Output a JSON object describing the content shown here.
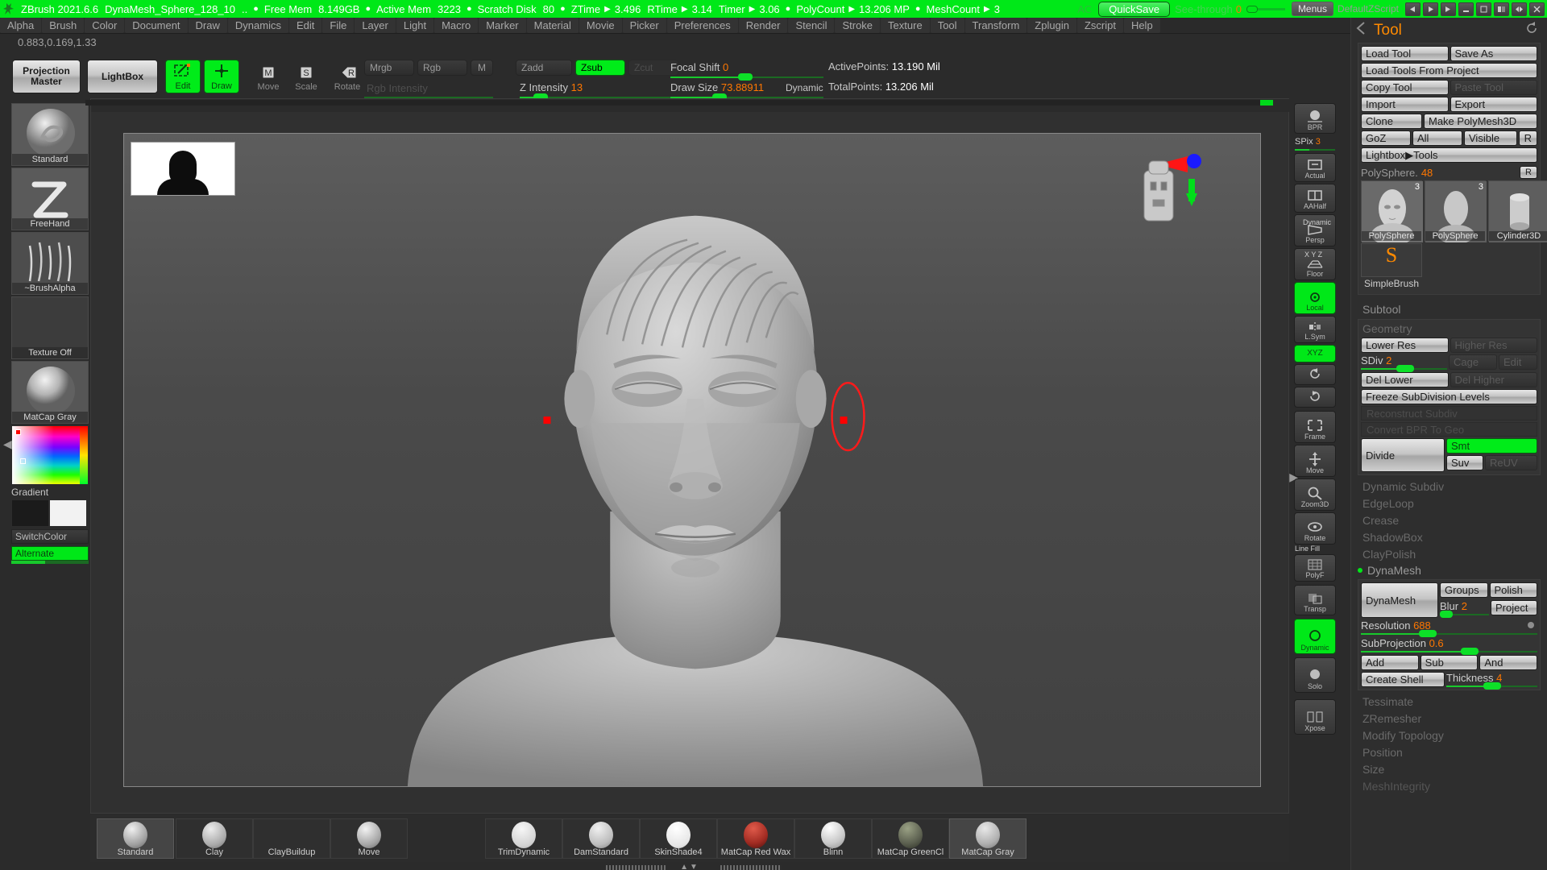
{
  "titlebar": {
    "app": "ZBrush 2021.6.6",
    "document": "DynaMesh_Sphere_128_10",
    "dots": "..",
    "stats": [
      {
        "label": "Free Mem",
        "value": "8.149GB"
      },
      {
        "label": "Active Mem",
        "value": "3223"
      },
      {
        "label": "Scratch Disk",
        "value": "80"
      },
      {
        "label": "ZTime",
        "value": "3.496",
        "arrow": true
      },
      {
        "label": "RTime",
        "value": "3.14",
        "arrow": true
      },
      {
        "label": "Timer",
        "value": "3.06",
        "arrow": true
      },
      {
        "label": "PolyCount",
        "value": "13.206 MP",
        "arrow": true
      },
      {
        "label": "MeshCount",
        "value": "3",
        "arrow": true
      }
    ],
    "ac_label": "AC",
    "quicksave": "QuickSave",
    "see_through_label": "See-through",
    "see_through_value": "0",
    "menus_button": "Menus",
    "default_zscript": "DefaultZScript"
  },
  "menubar": {
    "items": [
      "Alpha",
      "Brush",
      "Color",
      "Document",
      "Draw",
      "Dynamics",
      "Edit",
      "File",
      "Layer",
      "Light",
      "Macro",
      "Marker",
      "Material",
      "Movie",
      "Picker",
      "Preferences",
      "Render",
      "Stencil",
      "Stroke",
      "Texture",
      "Tool",
      "Transform",
      "Zplugin",
      "Zscript",
      "Help"
    ]
  },
  "coordinate_readout": "0.883,0.169,1.33",
  "toolbar": {
    "projection_master": "Projection Master",
    "lightbox": "LightBox",
    "edit": "Edit",
    "draw": "Draw",
    "move": "Move",
    "scale": "Scale",
    "rotate": "Rotate",
    "mrgb": "Mrgb",
    "rgb": "Rgb",
    "m": "M",
    "rgb_intensity_label": "Rgb Intensity",
    "zadd": "Zadd",
    "zsub": "Zsub",
    "zcut": "Zcut",
    "z_intensity_label": "Z Intensity",
    "z_intensity_value": "13",
    "focal_shift_label": "Focal Shift",
    "focal_shift_value": "0",
    "draw_size_label": "Draw Size",
    "draw_size_value": "73.88911",
    "dynamic_label": "Dynamic",
    "active_points_label": "ActivePoints:",
    "active_points_value": "13.190 Mil",
    "total_points_label": "TotalPoints:",
    "total_points_value": "13.206 Mil"
  },
  "left_palette": {
    "brush": {
      "label": "Standard",
      "icon": "brush-standard-icon"
    },
    "stroke": {
      "label": "FreeHand",
      "icon": "stroke-freehand-icon"
    },
    "alpha": {
      "label": "~BrushAlpha",
      "icon": "alpha-thumbnail-icon"
    },
    "texture": {
      "label": "Texture Off",
      "icon": "texture-off-icon"
    },
    "material": {
      "label": "MatCap Gray",
      "icon": "material-sphere-icon"
    },
    "gradient_label": "Gradient",
    "switch_color": "SwitchColor",
    "alternate": "Alternate"
  },
  "right_vstrip": {
    "items": [
      {
        "label": "BPR",
        "icon": "bpr-render-icon",
        "state": "normal"
      },
      {
        "label": "Actual",
        "icon": "actual-size-icon",
        "state": "normal"
      },
      {
        "label": "AAHalf",
        "icon": "aahalf-icon",
        "state": "normal"
      },
      {
        "label": "Persp",
        "icon": "perspective-icon",
        "state": "normal",
        "sub": "Dynamic"
      },
      {
        "label": "Floor",
        "icon": "floor-grid-icon",
        "state": "normal",
        "sub": "X Y Z"
      },
      {
        "label": "Local",
        "icon": "local-transform-icon",
        "state": "on"
      },
      {
        "label": "L.Sym",
        "icon": "local-symmetry-icon",
        "state": "normal"
      },
      {
        "label": "XYZ",
        "icon": "xyz-symmetry-icon",
        "state": "on"
      },
      {
        "label": "",
        "icon": "rotate-ccw-icon",
        "state": "normal"
      },
      {
        "label": "",
        "icon": "rotate-cw-icon",
        "state": "normal"
      },
      {
        "label": "Frame",
        "icon": "frame-icon",
        "state": "normal"
      },
      {
        "label": "Move",
        "icon": "move-view-icon",
        "state": "normal"
      },
      {
        "label": "Zoom3D",
        "icon": "zoom3d-icon",
        "state": "normal"
      },
      {
        "label": "Rotate",
        "icon": "rotate-view-icon",
        "state": "normal"
      },
      {
        "label": "PolyF",
        "icon": "polyframe-icon",
        "state": "normal",
        "sub": "Line Fill"
      },
      {
        "label": "Transp",
        "icon": "transparency-icon",
        "state": "normal"
      },
      {
        "label": "Dynamic",
        "icon": "dynamic-icon",
        "state": "on"
      },
      {
        "label": "Solo",
        "icon": "solo-icon",
        "state": "normal"
      },
      {
        "label": "Xpose",
        "icon": "xpose-icon",
        "state": "normal"
      }
    ],
    "spix_label": "SPix",
    "spix_value": "3"
  },
  "tool_panel": {
    "title": "Tool",
    "buttons": {
      "load_tool": "Load Tool",
      "save_as": "Save As",
      "load_tools_from_project": "Load Tools From Project",
      "copy_tool": "Copy Tool",
      "paste_tool": "Paste Tool",
      "import": "Import",
      "export": "Export",
      "clone": "Clone",
      "make_polymesh3d": "Make PolyMesh3D",
      "goz": "GoZ",
      "all": "All",
      "visible": "Visible",
      "r": "R",
      "lightbox_tools": "Lightbox▶Tools"
    },
    "polysphere_label": "PolySphere.",
    "polysphere_count": "48",
    "polysphere_r": "R",
    "thumbs": [
      {
        "name": "PolySphere",
        "num": "3"
      },
      {
        "name": "PolySphere",
        "num": "3"
      },
      {
        "name": "Cylinder3D",
        "num": ""
      }
    ],
    "simplebrush": "SimpleBrush",
    "subtool": "Subtool",
    "geometry": {
      "title": "Geometry",
      "lower_res": "Lower Res",
      "higher_res": "Higher Res",
      "sdiv_label": "SDiv",
      "sdiv_value": "2",
      "cage": "Cage",
      "edit_cage": "Edit",
      "del_lower": "Del Lower",
      "del_higher": "Del Higher",
      "freeze_subdivision_levels": "Freeze SubDivision Levels",
      "reconstruct_subdiv": "Reconstruct Subdiv",
      "convert_bpr_to_geo": "Convert BPR To Geo",
      "divide": "Divide",
      "smt": "Smt",
      "suv": "Suv",
      "reuv": "ReUV"
    },
    "disabled_sections": [
      "Dynamic Subdiv",
      "EdgeLoop",
      "Crease",
      "ShadowBox",
      "ClayPolish"
    ],
    "dynamesh": {
      "title": "DynaMesh",
      "button": "DynaMesh",
      "groups": "Groups",
      "polish": "Polish",
      "blur_label": "Blur",
      "blur_value": "2",
      "project": "Project",
      "resolution_label": "Resolution",
      "resolution_value": "688",
      "subprojection_label": "SubProjection",
      "subprojection_value": "0.6",
      "add": "Add",
      "sub": "Sub",
      "and": "And",
      "create_shell": "Create Shell",
      "thickness_label": "Thickness",
      "thickness_value": "4"
    },
    "more_sections": [
      "Tessimate",
      "ZRemesher",
      "Modify Topology",
      "Position",
      "Size",
      "MeshIntegrity"
    ]
  },
  "brush_bar": {
    "slots": [
      {
        "label": "Standard",
        "color": "#b9b9b9",
        "selected": true
      },
      {
        "label": "Clay",
        "color": "#c8c8c8",
        "selected": false
      },
      {
        "label": "ClayBuildup",
        "color": "#cacaca",
        "selected": false
      },
      {
        "label": "Move",
        "color": "#c4c4c4",
        "selected": false
      },
      {
        "label": "TrimDynamic",
        "color": "#d4d4d4",
        "selected": false
      },
      {
        "label": "DamStandard",
        "color": "#c6c6c6",
        "selected": false
      },
      {
        "label": "SkinShade4",
        "color": "#e8e8e8",
        "selected": false
      },
      {
        "label": "MatCap Red Wax",
        "color": "#a12b22",
        "selected": false
      },
      {
        "label": "Blinn",
        "color": "#cfcfcf",
        "selected": false
      },
      {
        "label": "MatCap GreenCl",
        "color": "#5c6050",
        "selected": false
      },
      {
        "label": "MatCap Gray",
        "color": "#b0b0b0",
        "selected": true
      }
    ]
  },
  "colors": {
    "accent_green": "#00e818",
    "orange_value": "#ff7700",
    "panel_bg": "#2e2e2e",
    "canvas_bg": "#4a4a4a"
  }
}
